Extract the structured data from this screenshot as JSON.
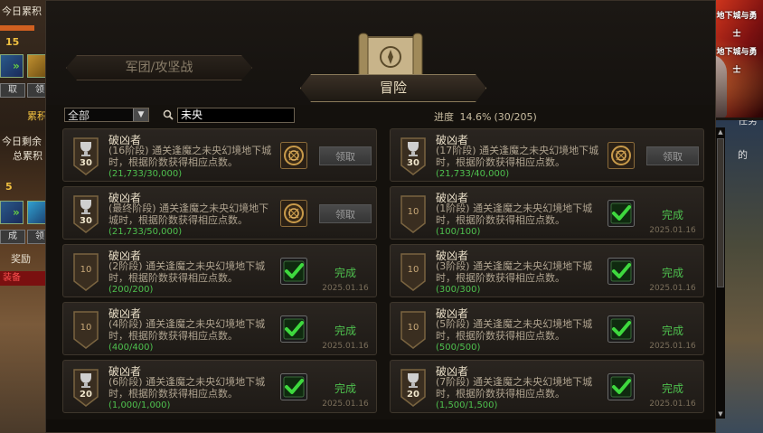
{
  "background": {
    "left": {
      "daily_label": "今日累积",
      "count_top": "15",
      "claim1": "取",
      "claim2": "领",
      "cumulative": "累积",
      "remaining": "今日剩余",
      "total": "总累积",
      "count_bottom": "5",
      "button_a": "成",
      "button_b": "领",
      "reward_label": "奖励",
      "equip_label": "装备"
    },
    "right": {
      "task_label": "任务",
      "item_label": "的"
    },
    "banner": {
      "logo_line1": "地下城与勇士",
      "logo_line2": "地下城与勇士"
    }
  },
  "tabs": {
    "siege": "军团/攻坚战",
    "adventure": "冒险"
  },
  "filter": {
    "category": "全部",
    "search_value": "未央",
    "dropdown_glyph": "▼"
  },
  "progress": {
    "label": "进度",
    "percent": "14.6%",
    "fraction": "(30/205)"
  },
  "achievements": [
    {
      "title": "破凶者",
      "desc": "(16阶段) 通关逢魔之未央幻境地下城时，根据阶数获得相应点数。",
      "count": "(21,733/30,000)",
      "points": "30",
      "type": "trophy",
      "state": "claim",
      "action": "领取",
      "date": ""
    },
    {
      "title": "破凶者",
      "desc": "(17阶段) 通关逢魔之未央幻境地下城时，根据阶数获得相应点数。",
      "count": "(21,733/40,000)",
      "points": "30",
      "type": "trophy",
      "state": "claim",
      "action": "领取",
      "date": ""
    },
    {
      "title": "破凶者",
      "desc": "(最终阶段) 通关逢魔之未央幻境地下城时，根据阶数获得相应点数。",
      "count": "(21,733/50,000)",
      "points": "30",
      "type": "trophy",
      "state": "claim",
      "action": "领取",
      "date": ""
    },
    {
      "title": "破凶者",
      "desc": "(1阶段) 通关逢魔之未央幻境地下城时，根据阶数获得相应点数。",
      "count": "(100/100)",
      "points": "10",
      "type": "plain",
      "state": "done",
      "action": "完成",
      "date": "2025.01.16"
    },
    {
      "title": "破凶者",
      "desc": "(2阶段) 通关逢魔之未央幻境地下城时，根据阶数获得相应点数。",
      "count": "(200/200)",
      "points": "10",
      "type": "plain",
      "state": "done",
      "action": "完成",
      "date": "2025.01.16"
    },
    {
      "title": "破凶者",
      "desc": "(3阶段) 通关逢魔之未央幻境地下城时，根据阶数获得相应点数。",
      "count": "(300/300)",
      "points": "10",
      "type": "plain",
      "state": "done",
      "action": "完成",
      "date": "2025.01.16"
    },
    {
      "title": "破凶者",
      "desc": "(4阶段) 通关逢魔之未央幻境地下城时，根据阶数获得相应点数。",
      "count": "(400/400)",
      "points": "10",
      "type": "plain",
      "state": "done",
      "action": "完成",
      "date": "2025.01.16"
    },
    {
      "title": "破凶者",
      "desc": "(5阶段) 通关逢魔之未央幻境地下城时，根据阶数获得相应点数。",
      "count": "(500/500)",
      "points": "10",
      "type": "plain",
      "state": "done",
      "action": "完成",
      "date": "2025.01.16"
    },
    {
      "title": "破凶者",
      "desc": "(6阶段) 通关逢魔之未央幻境地下城时，根据阶数获得相应点数。",
      "count": "(1,000/1,000)",
      "points": "20",
      "type": "trophy",
      "state": "done",
      "action": "完成",
      "date": "2025.01.16"
    },
    {
      "title": "破凶者",
      "desc": "(7阶段) 通关逢魔之未央幻境地下城时，根据阶数获得相应点数。",
      "count": "(1,500/1,500)",
      "points": "20",
      "type": "trophy",
      "state": "done",
      "action": "完成",
      "date": "2025.01.16"
    }
  ],
  "scroll": {
    "up": "▲",
    "down": "▼"
  },
  "colors": {
    "accent_green": "#4ec04e",
    "panel_bg": "#14110d",
    "gold_text": "#eadfc8"
  }
}
